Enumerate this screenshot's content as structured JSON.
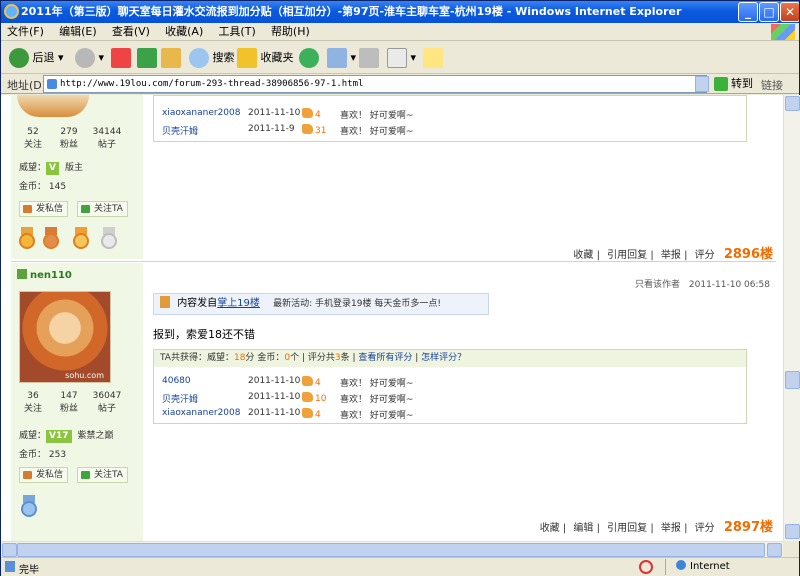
{
  "window": {
    "title": "2011年（第三版）聊天室每日灌水交流报到加分贴（相互加分）-第97页-淮车主聊车室-杭州19楼 - Windows Internet Explorer",
    "minimize": "_",
    "maximize": "□",
    "close": "✕"
  },
  "menu": {
    "items": [
      "文件(F)",
      "编辑(E)",
      "查看(V)",
      "收藏(A)",
      "工具(T)",
      "帮助(H)"
    ]
  },
  "toolbar": {
    "back_label": "后退",
    "search_label": "搜索",
    "favorites_label": "收藏夹"
  },
  "address": {
    "label": "地址(D)",
    "url": "http://www.19lou.com/forum-293-thread-38906856-97-1.html",
    "go_label": "转到",
    "links_label": "链接"
  },
  "post1": {
    "stats": [
      {
        "value": "52",
        "label": "关注"
      },
      {
        "value": "279",
        "label": "粉丝"
      },
      {
        "value": "34144",
        "label": "帖子"
      }
    ],
    "prestige_label": "威望：",
    "level_badge": "V",
    "level_name": "版主",
    "coins_label": "金币：",
    "coins": "145",
    "pm_label": "发私信",
    "follow_label": "关注TA",
    "rates": [
      {
        "user": "xiaoxananer2008",
        "time": "2011-11-10",
        "score": "4",
        "reason": "喜欢！ 好可爱啊~"
      },
      {
        "user": "贝壳汗姆",
        "time": "2011-11-9",
        "score": "31",
        "reason": "喜欢！ 好可爱啊~"
      }
    ],
    "actions": [
      "收藏",
      "引用回复",
      "举报",
      "评分"
    ],
    "floor": "2896楼"
  },
  "post2": {
    "username": "nen110",
    "avatar_watermark": "sohu.com",
    "stats": [
      {
        "value": "36",
        "label": "关注"
      },
      {
        "value": "147",
        "label": "粉丝"
      },
      {
        "value": "36047",
        "label": "帖子"
      }
    ],
    "prestige_label": "威望：",
    "level_badge": "V17",
    "level_name": "紫禁之巅",
    "coins_label": "金币：",
    "coins": "253",
    "pm_label": "发私信",
    "follow_label": "关注TA",
    "only_author": "只看该作者",
    "post_time": "2011-11-10 06:58",
    "mobile_text": "内容发自",
    "mobile_link": "掌上19楼",
    "news_text": "最新活动: 手机登录19楼 每天金币多一点!",
    "body": "报到，索爱18还不错",
    "rate_summary": {
      "prefix": "TA共获得：威望：",
      "prestige": "18",
      "prestige_unit": "分",
      "coins_label": "金币：",
      "coins": "0",
      "coins_unit": "个",
      "count_prefix": "评分共",
      "count": "3",
      "count_unit": "条",
      "view_all": "查看所有评分",
      "how": "怎样评分？"
    },
    "rates": [
      {
        "user": "40680",
        "time": "2011-11-10",
        "score": "4",
        "reason": "喜欢！ 好可爱啊~"
      },
      {
        "user": "贝壳汗姆",
        "time": "2011-11-10",
        "score": "10",
        "reason": "喜欢！ 好可爱啊~"
      },
      {
        "user": "xiaoxananer2008",
        "time": "2011-11-10",
        "score": "4",
        "reason": "喜欢！ 好可爱啊~"
      }
    ],
    "actions": [
      "收藏",
      "编辑",
      "引用回复",
      "举报",
      "评分"
    ],
    "floor": "2897楼"
  },
  "status": {
    "text": "完毕",
    "zone": "Internet"
  }
}
